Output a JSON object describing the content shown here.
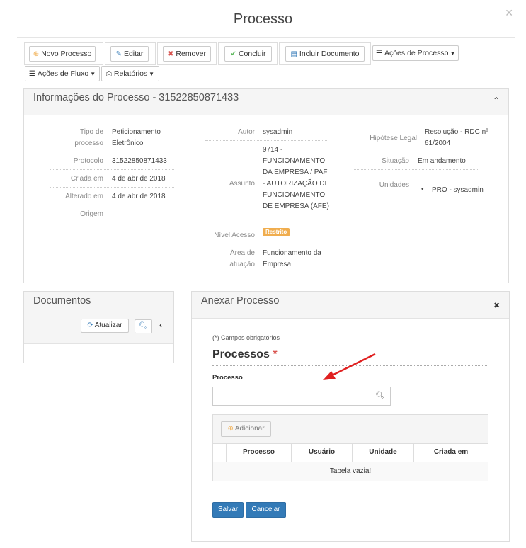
{
  "page": {
    "title": "Processo"
  },
  "toolbar": {
    "novo_processo": "Novo Processo",
    "editar": "Editar",
    "remover": "Remover",
    "concluir": "Concluir",
    "incluir_documento": "Incluir Documento",
    "acoes_processo": "Ações de Processo",
    "acoes_fluxo": "Ações de Fluxo",
    "relatorios": "Relatórios"
  },
  "info": {
    "title": "Informações do Processo - 31522850871433",
    "col1": [
      {
        "label": "Tipo de processo",
        "value": "Peticionamento Eletrônico"
      },
      {
        "label": "Protocolo",
        "value": "31522850871433"
      },
      {
        "label": "Criada em",
        "value": "4 de abr de 2018"
      },
      {
        "label": "Alterado em",
        "value": "4 de abr de 2018"
      },
      {
        "label": "Origem",
        "value": ""
      }
    ],
    "col2": [
      {
        "label": "Autor",
        "value": "sysadmin"
      },
      {
        "label": "Assunto",
        "value": "9714 - FUNCIONAMENTO DA EMPRESA / PAF - AUTORIZAÇÃO DE FUNCIONAMENTO DE EMPRESA (AFE)"
      },
      {
        "label": "Nível Acesso",
        "value": "Restrito"
      },
      {
        "label": "Área de atuação",
        "value": "Funcionamento da Empresa"
      }
    ],
    "col3": [
      {
        "label": "Hipótese Legal",
        "value": "Resolução - RDC nº 61/2004"
      },
      {
        "label": "Situação",
        "value": "Em andamento"
      },
      {
        "label": "Unidades",
        "value": "PRO - sysadmin"
      }
    ]
  },
  "documentos": {
    "title": "Documentos",
    "atualizar": "Atualizar"
  },
  "anexar": {
    "title": "Anexar Processo",
    "required_note": "(*) Campos obrigatórios",
    "section_title": "Processos",
    "asterisk": "*",
    "field_label": "Processo",
    "input_value": "",
    "adicionar": "Adicionar",
    "table": {
      "columns": [
        "Processo",
        "Usuário",
        "Unidade",
        "Criada em"
      ],
      "empty": "Tabela vazia!"
    },
    "salvar": "Salvar",
    "cancelar": "Cancelar"
  },
  "colors": {
    "primary": "#337ab7",
    "warning": "#f0ad4e",
    "danger": "#d9534f",
    "success": "#5cb85c",
    "annotation_arrow": "#e02020"
  }
}
